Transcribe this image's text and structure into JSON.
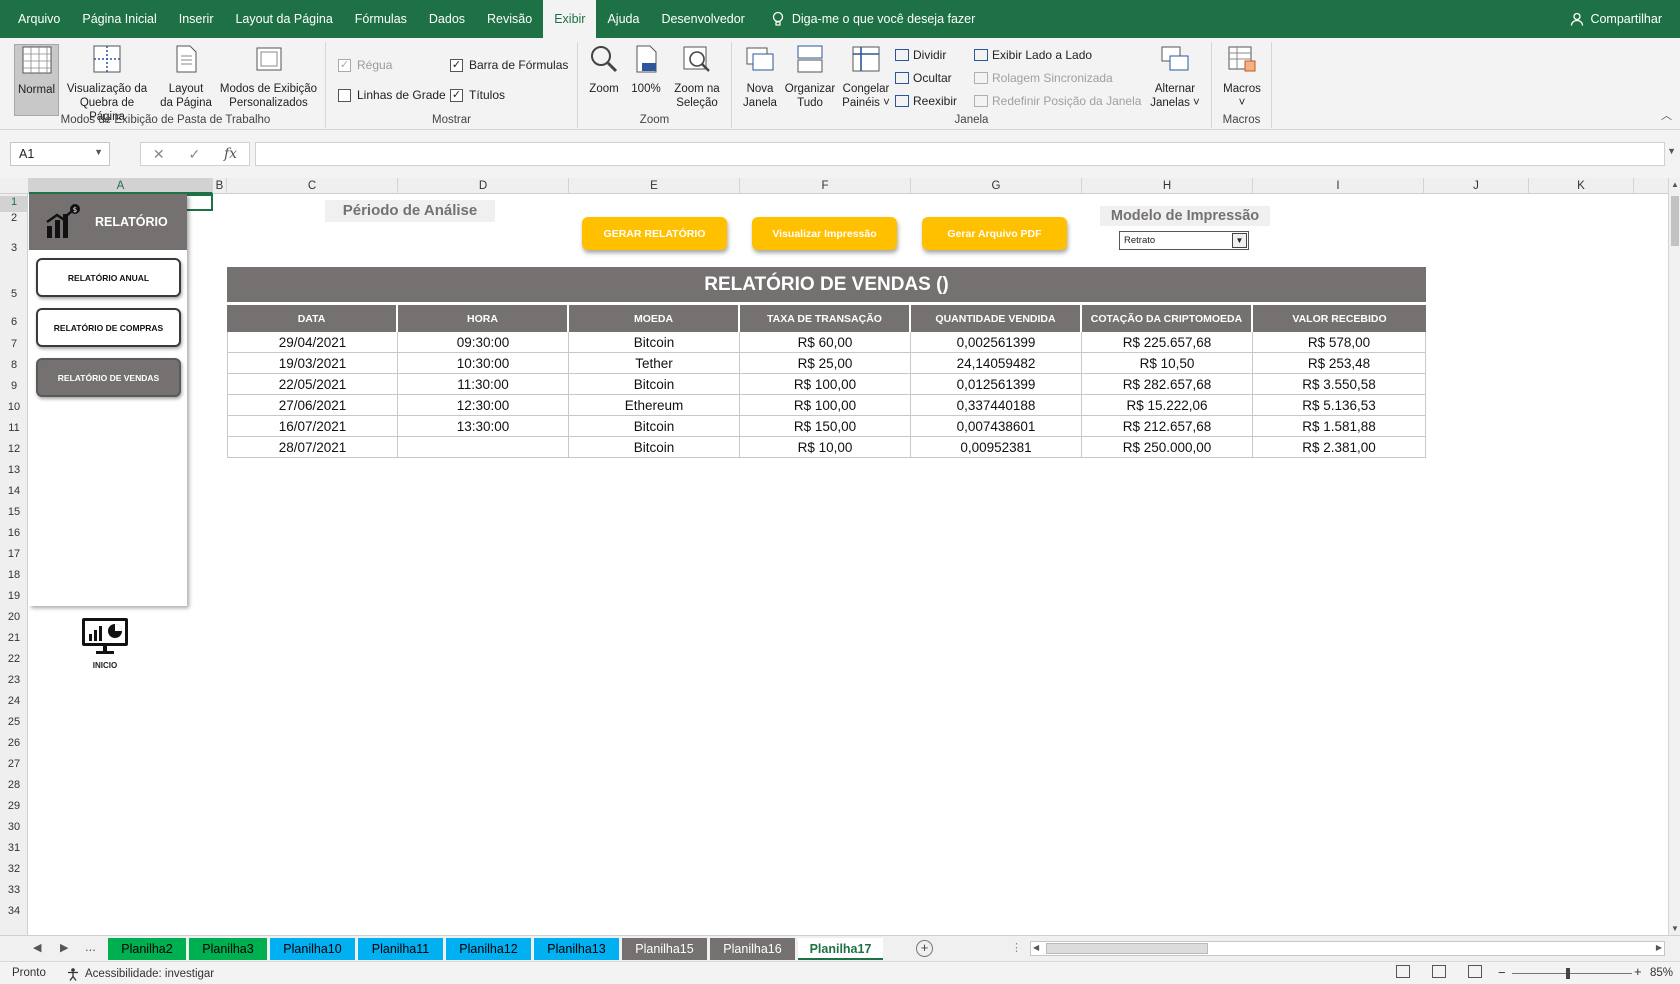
{
  "menu": {
    "tabs": [
      "Arquivo",
      "Página Inicial",
      "Inserir",
      "Layout da Página",
      "Fórmulas",
      "Dados",
      "Revisão",
      "Exibir",
      "Ajuda",
      "Desenvolvedor"
    ],
    "active_index": 7,
    "tell_me": "Diga-me o que você deseja fazer",
    "share": "Compartilhar"
  },
  "ribbon": {
    "views_group": {
      "label": "Modos de Exibição de Pasta de Trabalho",
      "normal": "Normal",
      "page_break_1": "Visualização da",
      "page_break_2": "Quebra de Página",
      "page_layout_1": "Layout",
      "page_layout_2": "da Página",
      "custom_1": "Modos de Exibição",
      "custom_2": "Personalizados"
    },
    "show_group": {
      "label": "Mostrar",
      "ruler": "Régua",
      "gridlines": "Linhas de Grade",
      "formula_bar": "Barra de Fórmulas",
      "headings": "Títulos"
    },
    "zoom_group": {
      "label": "Zoom",
      "zoom": "Zoom",
      "hundred": "100%",
      "zoom_sel_1": "Zoom na",
      "zoom_sel_2": "Seleção"
    },
    "window_group": {
      "label": "Janela",
      "new_1": "Nova",
      "new_2": "Janela",
      "arrange_1": "Organizar",
      "arrange_2": "Tudo",
      "freeze_1": "Congelar",
      "freeze_2": "Painéis ˅",
      "split": "Dividir",
      "hide": "Ocultar",
      "unhide": "Reexibir",
      "side_by_side": "Exibir Lado a Lado",
      "sync_scroll": "Rolagem Sincronizada",
      "reset_pos": "Redefinir Posição da Janela",
      "switch_1": "Alternar",
      "switch_2": "Janelas ˅"
    },
    "macros_group": {
      "label": "Macros",
      "macros": "Macros",
      "caret": "˅"
    }
  },
  "formula_bar": {
    "name_box": "A1",
    "cancel": "✕",
    "enter": "✓",
    "fx": "fx",
    "value": ""
  },
  "columns": [
    "A",
    "B",
    "C",
    "D",
    "E",
    "F",
    "G",
    "H",
    "I",
    "J",
    "K"
  ],
  "rows": [
    "1",
    "2",
    "3",
    "5",
    "6",
    "7",
    "8",
    "9",
    "10",
    "11",
    "12",
    "13",
    "14",
    "15",
    "16",
    "17",
    "18",
    "19",
    "20",
    "21",
    "22",
    "23",
    "24",
    "25",
    "26",
    "27",
    "28",
    "29",
    "30",
    "31",
    "32",
    "33",
    "34"
  ],
  "side_panel": {
    "title": "RELATÓRIO",
    "buttons": [
      "RELATÓRIO ANUAL",
      "RELATÓRIO DE COMPRAS",
      "RELATÓRIO DE VENDAS"
    ],
    "active_index": 2,
    "home_label": "INICIO"
  },
  "controls": {
    "period_label": "Périodo de Análise",
    "print_model_label": "Modelo de Impressão",
    "print_model_value": "Retrato",
    "gen_report": "GERAR RELATÓRIO",
    "view_print": "Visualizar Impressão",
    "gen_pdf": "Gerar Arquivo PDF"
  },
  "report": {
    "title": "RELATÓRIO DE VENDAS ()",
    "headers": [
      "DATA",
      "HORA",
      "MOEDA",
      "TAXA DE TRANSAÇÃO",
      "QUANTIDADE VENDIDA",
      "COTAÇÃO DA CRIPTOMOEDA",
      "VALOR RECEBIDO"
    ],
    "rows": [
      [
        "29/04/2021",
        "09:30:00",
        "Bitcoin",
        "R$ 60,00",
        "0,002561399",
        "R$ 225.657,68",
        "R$ 578,00"
      ],
      [
        "19/03/2021",
        "10:30:00",
        "Tether",
        "R$ 25,00",
        "24,14059482",
        "R$ 10,50",
        "R$ 253,48"
      ],
      [
        "22/05/2021",
        "11:30:00",
        "Bitcoin",
        "R$ 100,00",
        "0,012561399",
        "R$ 282.657,68",
        "R$ 3.550,58"
      ],
      [
        "27/06/2021",
        "12:30:00",
        "Ethereum",
        "R$ 100,00",
        "0,337440188",
        "R$ 15.222,06",
        "R$ 5.136,53"
      ],
      [
        "16/07/2021",
        "13:30:00",
        "Bitcoin",
        "R$ 150,00",
        "0,007438601",
        "R$ 212.657,68",
        "R$ 1.581,88"
      ],
      [
        "28/07/2021",
        "",
        "Bitcoin",
        "R$ 10,00",
        "0,00952381",
        "R$ 250.000,00",
        "R$ 2.381,00"
      ]
    ]
  },
  "sheet_tabs": {
    "ellipsis": "...",
    "tabs": [
      {
        "name": "Planilha2",
        "color": "#00b050"
      },
      {
        "name": "Planilha3",
        "color": "#00b050"
      },
      {
        "name": "Planilha10",
        "color": "#00b0f0"
      },
      {
        "name": "Planilha11",
        "color": "#00b0f0"
      },
      {
        "name": "Planilha12",
        "color": "#00b0f0"
      },
      {
        "name": "Planilha13",
        "color": "#00b0f0"
      },
      {
        "name": "Planilha15",
        "color": "#767171"
      },
      {
        "name": "Planilha16",
        "color": "#767171"
      },
      {
        "name": "Planilha17",
        "color": "#ffffff"
      }
    ],
    "active_index": 8
  },
  "status": {
    "ready": "Pronto",
    "accessibility": "Acessibilidade: investigar",
    "zoom": "85%"
  },
  "colors": {
    "excel_green": "#1e7145",
    "panel_gray": "#767171",
    "button_orange": "#ffc000"
  }
}
